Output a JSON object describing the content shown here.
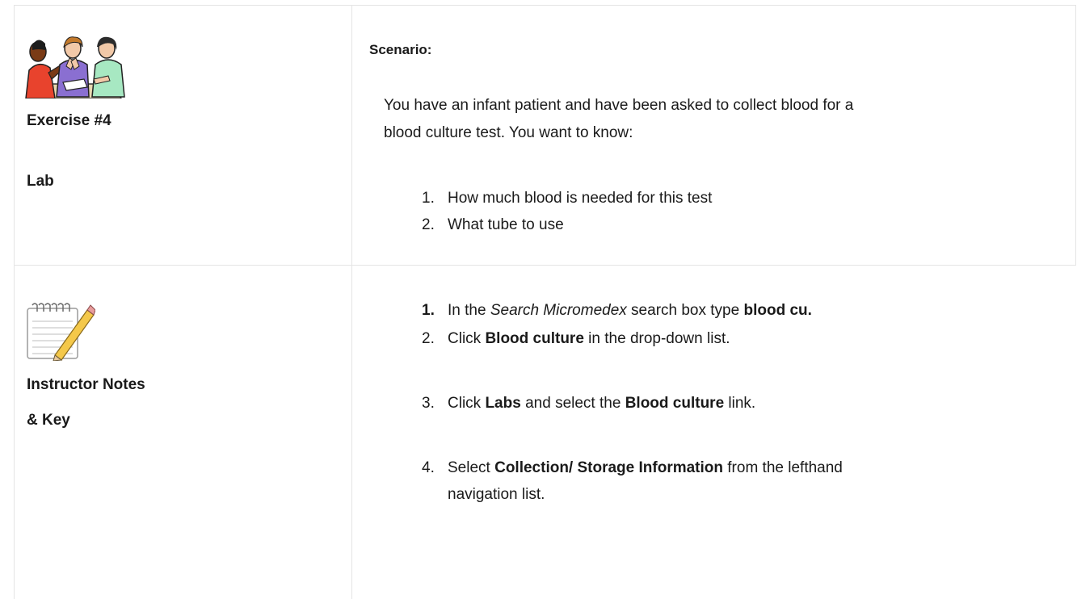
{
  "row1": {
    "left": {
      "icon": "people-talking-clipart",
      "title": "Exercise #4",
      "subtitle": "Lab"
    },
    "right": {
      "heading": "Scenario:",
      "paragraph_line1": "You have an infant patient and have been asked to collect blood for a",
      "paragraph_line2": "blood culture test. You want to know:",
      "items": [
        {
          "num": "1.",
          "text": "How much blood is needed for this test"
        },
        {
          "num": "2.",
          "text": "What tube to use"
        }
      ]
    }
  },
  "row2": {
    "left": {
      "icon": "notepad-pencil-icon",
      "title_line1": "Instructor Notes",
      "title_line2": "& Key"
    },
    "right": {
      "steps": [
        {
          "num": "1.",
          "t1": "In the ",
          "i1": "Search Micromedex",
          "t2": " search box type ",
          "b1": "blood cu."
        },
        {
          "num": "2.",
          "t1": "Click ",
          "b1": "Blood culture",
          "t2": " in the drop-down list."
        },
        {
          "num": "3.",
          "t1": "Click ",
          "b1": "Labs",
          "t2": " and select the ",
          "b2": "Blood culture",
          "t3": " link."
        },
        {
          "num": "4.",
          "t1": "Select ",
          "b1": "Collection/ Storage Information",
          "t2": " from the lefthand",
          "line2": "navigation list."
        }
      ]
    }
  }
}
